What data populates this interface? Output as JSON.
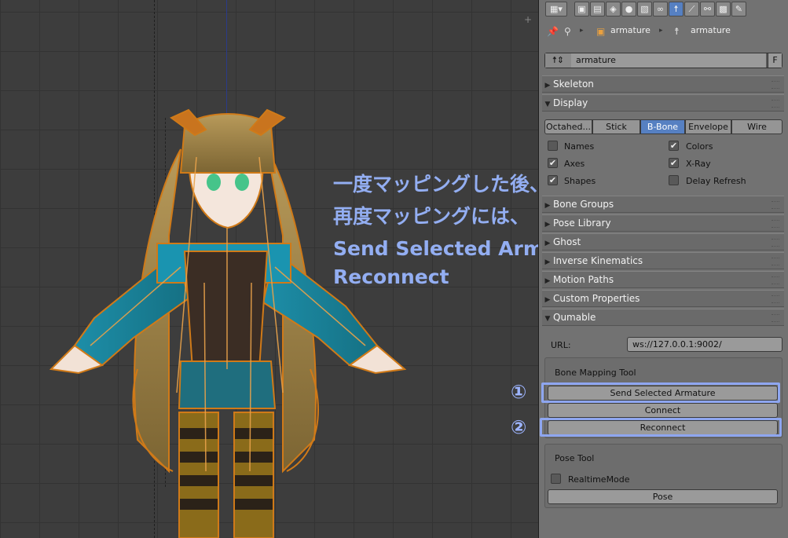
{
  "viewport": {
    "annotation_lines": [
      "一度マッピングした後、",
      "再度マッピングには、",
      "Send Selected Armatureして",
      "Reconnect"
    ]
  },
  "properties": {
    "tab_icons": [
      "render-icon",
      "render-layers-icon",
      "scene-icon",
      "world-icon",
      "object-icon",
      "constraints-icon",
      "armature-data-icon",
      "bone-icon",
      "bone-constraints-icon",
      "material-icon",
      "texture-icon"
    ],
    "active_tab": "armature-data-icon",
    "breadcrumb": {
      "object": "armature",
      "data": "armature"
    },
    "datablock_name": "armature",
    "fake_user": "F",
    "panels": {
      "skeleton": "Skeleton",
      "display": "Display",
      "bone_groups": "Bone Groups",
      "pose_library": "Pose Library",
      "ghost": "Ghost",
      "inverse_kinematics": "Inverse Kinematics",
      "motion_paths": "Motion Paths",
      "custom_properties": "Custom Properties",
      "qumable": "Qumable"
    },
    "display": {
      "modes": [
        "Octahed...",
        "Stick",
        "B-Bone",
        "Envelope",
        "Wire"
      ],
      "active_mode": "B-Bone",
      "options": {
        "names": {
          "label": "Names",
          "checked": false
        },
        "colors": {
          "label": "Colors",
          "checked": true
        },
        "axes": {
          "label": "Axes",
          "checked": true
        },
        "xray": {
          "label": "X-Ray",
          "checked": true
        },
        "shapes": {
          "label": "Shapes",
          "checked": true
        },
        "delay_refresh": {
          "label": "Delay Refresh",
          "checked": false
        }
      }
    },
    "qumable": {
      "url_label": "URL:",
      "url_value": "ws://127.0.0.1:9002/",
      "bone_mapping_tool": "Bone Mapping Tool",
      "send_selected_armature": "Send Selected Armature",
      "connect": "Connect",
      "reconnect": "Reconnect",
      "pose_tool": "Pose Tool",
      "realtime_mode": {
        "label": "RealtimeMode",
        "checked": false
      },
      "pose": "Pose"
    }
  },
  "callouts": {
    "one": "①",
    "two": "②"
  },
  "colors": {
    "accent": "#5680c2",
    "annotation": "#93aef2",
    "highlight": "#8ea6f0"
  }
}
